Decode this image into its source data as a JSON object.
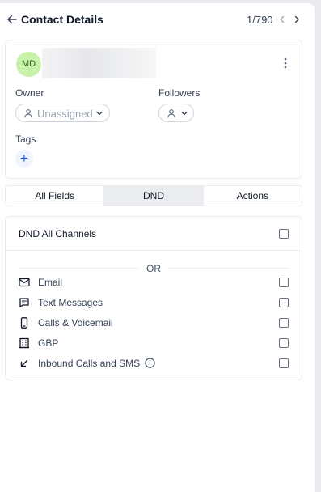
{
  "header": {
    "title": "Contact Details",
    "counter": "1/790"
  },
  "contact": {
    "avatar_initials": "MD",
    "owner_label": "Owner",
    "owner_value": "Unassigned",
    "followers_label": "Followers",
    "tags_label": "Tags",
    "add_tag_symbol": "+"
  },
  "tabs": [
    {
      "label": "All Fields",
      "active": false
    },
    {
      "label": "DND",
      "active": true
    },
    {
      "label": "Actions",
      "active": false
    }
  ],
  "dnd": {
    "all_channels_label": "DND All Channels",
    "separator": "OR",
    "channels": [
      {
        "label": "Email",
        "icon": "mail-icon"
      },
      {
        "label": "Text Messages",
        "icon": "message-icon"
      },
      {
        "label": "Calls & Voicemail",
        "icon": "phone-icon"
      },
      {
        "label": "GBP",
        "icon": "building-icon"
      },
      {
        "label": "Inbound Calls and SMS",
        "icon": "arrow-down-left-icon"
      }
    ]
  },
  "colors": {
    "accent": "#155eef",
    "avatar_bg": "#c8f1a9",
    "active_tab_bg": "#eaecf0"
  }
}
